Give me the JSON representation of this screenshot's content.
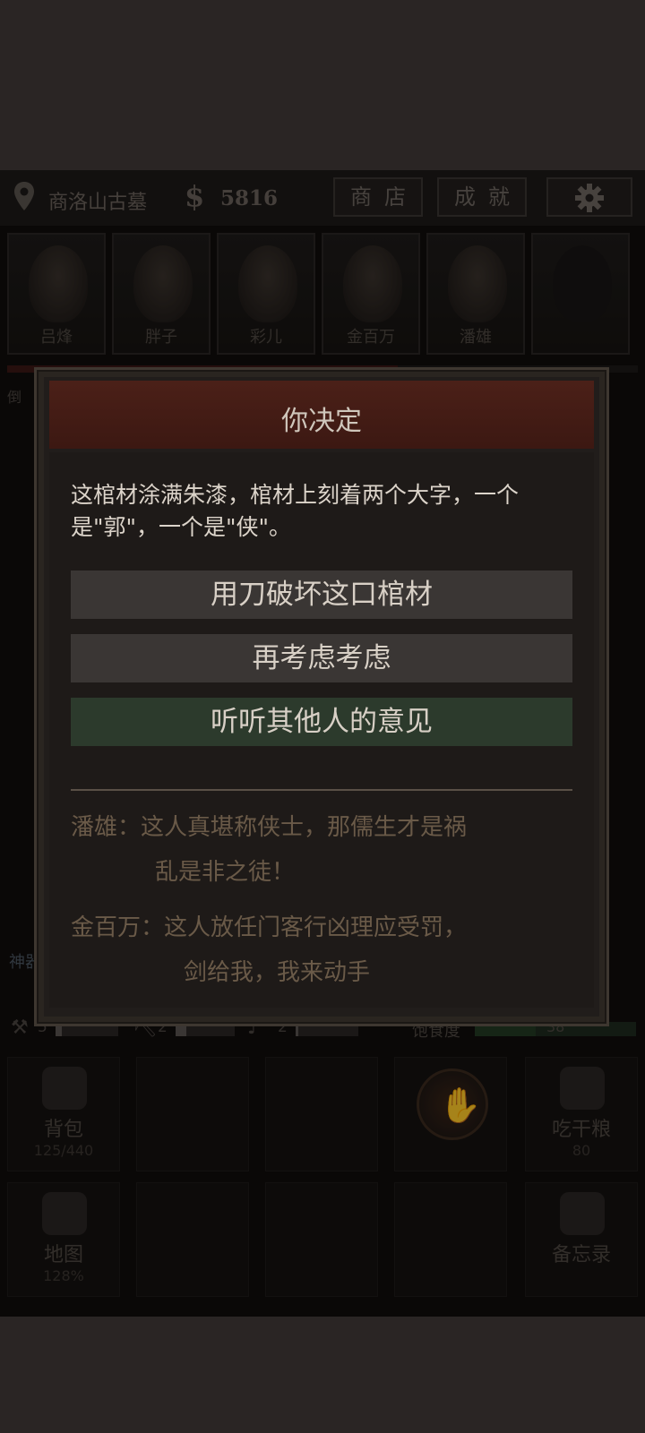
{
  "header": {
    "location": "商洛山古墓",
    "money_symbol": "$",
    "money": "5816",
    "shop_label": "商店",
    "achievements_label": "成就"
  },
  "portraits": [
    {
      "name": "吕烽"
    },
    {
      "name": "胖子"
    },
    {
      "name": "彩儿"
    },
    {
      "name": "金百万"
    },
    {
      "name": "潘雄"
    },
    {
      "name": ""
    }
  ],
  "side_glyph": "倒",
  "left_tag": "神器",
  "status": {
    "axe": "5",
    "pick": "2",
    "shovel": "2",
    "hunger_label": "饱食度",
    "hunger_value": "38"
  },
  "grid": {
    "backpack_label": "背包",
    "backpack_count": "125/440",
    "eat_label": "吃干粮",
    "eat_count": "80",
    "map_label": "地图",
    "map_pct": "128%",
    "memo_label": "备忘录"
  },
  "dialog": {
    "title": "你决定",
    "text": "这棺材涂满朱漆，棺材上刻着两个大字，一个是\"郭\"，一个是\"侠\"。",
    "choices": [
      "用刀破坏这口棺材",
      "再考虑考虑",
      "听听其他人的意见"
    ],
    "comments": [
      {
        "speaker": "潘雄：",
        "line1": "这人真堪称侠士，那儒生才是祸",
        "line2": "乱是非之徒！"
      },
      {
        "speaker": "金百万：",
        "line1": "这人放任门客行凶理应受罚，",
        "line2": "剑给我，我来动手"
      }
    ]
  },
  "colors": {
    "dialog_header": "#4b2018",
    "choice_default": "#3a3634",
    "choice_highlight": "#2c3a2c",
    "comment_text": "#6a5a48"
  }
}
